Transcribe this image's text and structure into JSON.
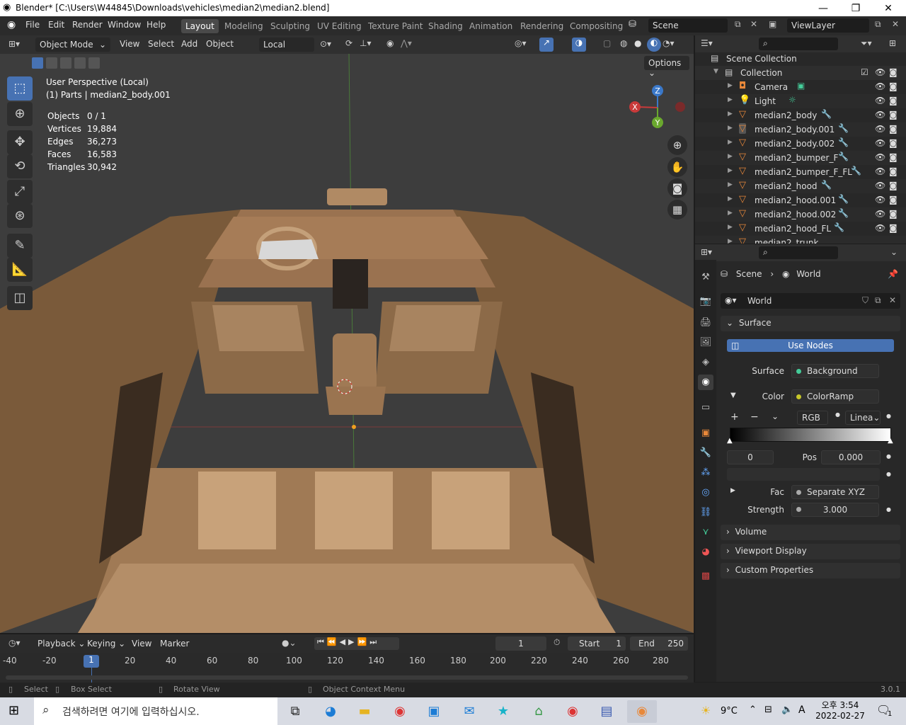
{
  "window": {
    "title": "Blender* [C:\\Users\\W44845\\Downloads\\vehicles\\median2\\median2.blend]"
  },
  "menu": [
    "File",
    "Edit",
    "Render",
    "Window",
    "Help"
  ],
  "workspaces": [
    "Layout",
    "Modeling",
    "Sculpting",
    "UV Editing",
    "Texture Paint",
    "Shading",
    "Animation",
    "Rendering",
    "Compositing"
  ],
  "scene": "Scene",
  "view_layer": "ViewLayer",
  "viewport_header": {
    "mode": "Object Mode",
    "menus": [
      "View",
      "Select",
      "Add",
      "Object"
    ],
    "orientation": "Local",
    "options": "Options"
  },
  "viewport_info": {
    "line1": "User Perspective (Local)",
    "line2": "(1) Parts | median2_body.001"
  },
  "stats": [
    {
      "label": "Objects",
      "value": "0 / 1"
    },
    {
      "label": "Vertices",
      "value": "19,884"
    },
    {
      "label": "Edges",
      "value": "36,273"
    },
    {
      "label": "Faces",
      "value": "16,583"
    },
    {
      "label": "Triangles",
      "value": "30,942"
    }
  ],
  "gizmo": {
    "x": "X",
    "y": "Y",
    "z": "Z"
  },
  "outliner": {
    "root": "Scene Collection",
    "collection": "Collection",
    "items": [
      "Camera",
      "Light",
      "median2_body",
      "median2_body.001",
      "median2_body.002",
      "median2_bumper_F",
      "median2_bumper_F_FL",
      "median2_hood",
      "median2_hood.001",
      "median2_hood.002",
      "median2_hood_FL",
      "median2_trunk"
    ]
  },
  "properties": {
    "breadcrumb": [
      "Scene",
      "World"
    ],
    "world_name": "World",
    "surface_panel": "Surface",
    "use_nodes": "Use Nodes",
    "surface_label": "Surface",
    "surface_value": "Background",
    "color_label": "Color",
    "color_value": "ColorRamp",
    "ramp_mode": "RGB",
    "ramp_interp": "Linea",
    "ramp_index": "0",
    "pos_label": "Pos",
    "pos_value": "0.000",
    "fac_label": "Fac",
    "fac_value": "Separate XYZ",
    "strength_label": "Strength",
    "strength_value": "3.000",
    "collapsed_panels": [
      "Volume",
      "Viewport Display",
      "Custom Properties"
    ]
  },
  "timeline": {
    "menus": [
      "Playback",
      "Keying",
      "View",
      "Marker"
    ],
    "current_frame": "1",
    "start_label": "Start",
    "start": "1",
    "end_label": "End",
    "end": "250",
    "ticks": [
      "-40",
      "-20",
      "1",
      "20",
      "40",
      "60",
      "80",
      "100",
      "120",
      "140",
      "160",
      "180",
      "200",
      "220",
      "240",
      "260",
      "280"
    ]
  },
  "statusbar": {
    "select": "Select",
    "box_select": "Box Select",
    "rotate": "Rotate View",
    "context": "Object Context Menu",
    "version": "3.0.1"
  },
  "taskbar": {
    "search_placeholder": "검색하려면 여기에 입력하십시오.",
    "weather": "9°C",
    "time": "오후 3:54",
    "date": "2022-02-27",
    "ime": "A",
    "notif_count": "1"
  }
}
